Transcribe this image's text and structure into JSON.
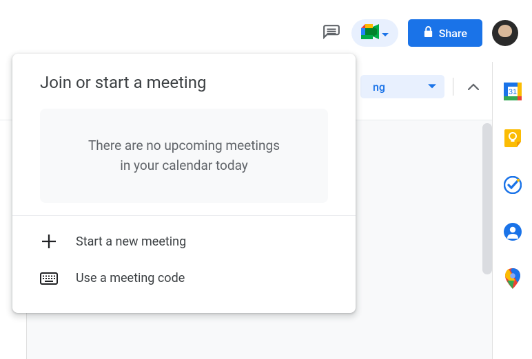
{
  "toolbar": {
    "share_label": "Share",
    "editing_label_fragment": "ng"
  },
  "meet_panel": {
    "title": "Join or start a meeting",
    "empty_line1": "There are no upcoming meetings",
    "empty_line2": "in your calendar today",
    "start_new_label": "Start a new meeting",
    "use_code_label": "Use a meeting code"
  },
  "sidebar": {
    "calendar_day": "31"
  }
}
